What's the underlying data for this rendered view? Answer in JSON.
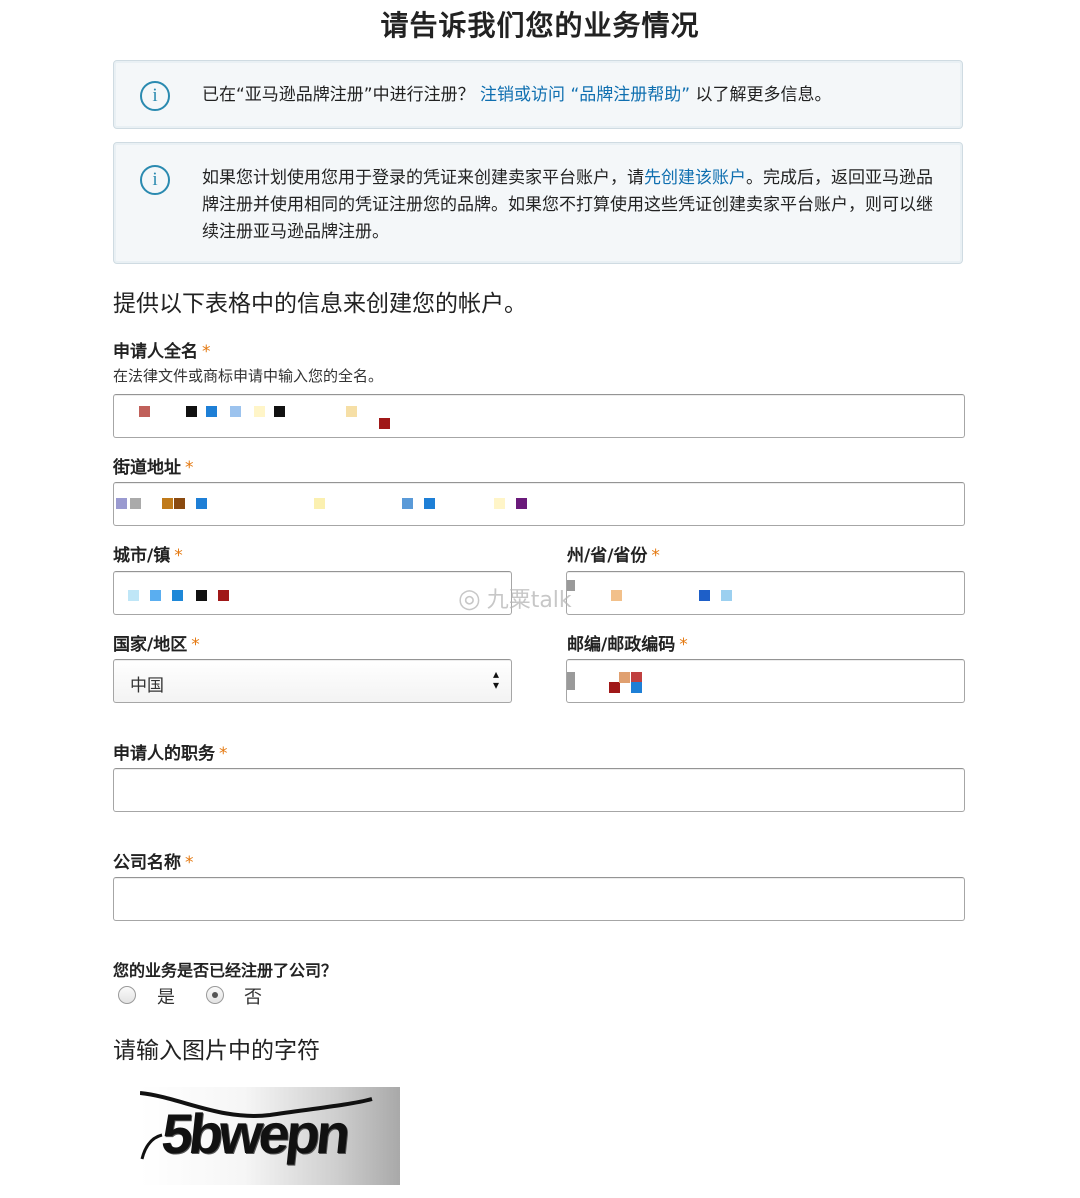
{
  "page": {
    "title": "请告诉我们您的业务情况"
  },
  "alerts": [
    {
      "icon": "info-icon",
      "prefix": "已在“亚马逊品牌注册”中进行注册？",
      "link1": "注销或访问",
      "link2": "“品牌注册帮助”",
      "suffix": "以了解更多信息。"
    },
    {
      "icon": "info-icon",
      "prefix": "如果您计划使用您用于登录的凭证来创建卖家平台账户，请",
      "link": "先创建该账户",
      "suffix": "。完成后，返回亚马逊品牌注册并使用相同的凭证注册您的品牌。如果您不打算使用这些凭证创建卖家平台账户，则可以继续注册亚马逊品牌注册。"
    }
  ],
  "form": {
    "intro": "提供以下表格中的信息来创建您的帐户。",
    "required_mark": "*",
    "full_name": {
      "label": "申请人全名",
      "hint": "在法律文件或商标申请中输入您的全名。"
    },
    "street": {
      "label": "街道地址"
    },
    "city": {
      "label": "城市/镇"
    },
    "state": {
      "label": "州/省/省份"
    },
    "country": {
      "label": "国家/地区",
      "value": "中国"
    },
    "postal": {
      "label": "邮编/邮政编码"
    },
    "job_title": {
      "label": "申请人的职务",
      "value": ""
    },
    "company": {
      "label": "公司名称",
      "value": ""
    },
    "registered": {
      "question": "您的业务是否已经注册了公司？",
      "options": [
        "是",
        "否"
      ],
      "selected": "否"
    },
    "captcha": {
      "title": "请输入图片中的字符",
      "image_text": "5bwepn"
    }
  },
  "watermark": {
    "text": "九粟talk"
  },
  "colors": {
    "link": "#0f6fb0",
    "required": "#e47911",
    "info": "#2a8ab0"
  }
}
